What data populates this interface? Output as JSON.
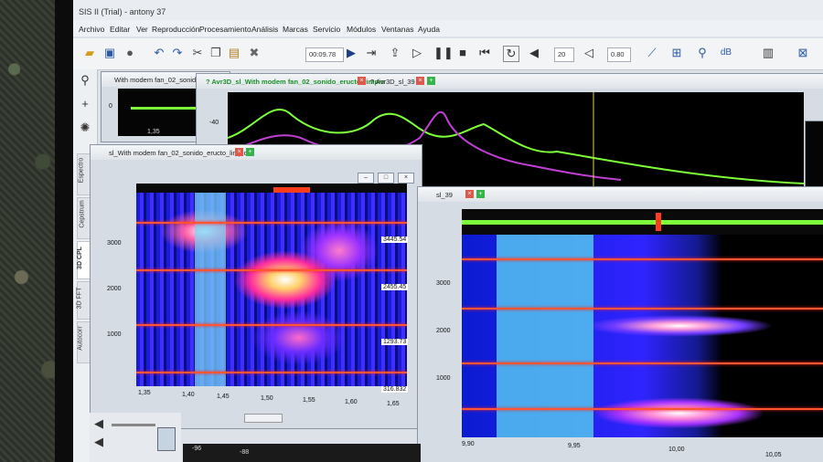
{
  "app": {
    "title": "SIS II (Trial) - antony 37"
  },
  "menu": [
    "Archivo",
    "Editar",
    "Ver",
    "Reproducción",
    "Procesamiento",
    "Análisis",
    "Marcas",
    "Servicio",
    "Módulos",
    "Ventanas",
    "Ayuda"
  ],
  "toolbar": {
    "time": "00:09.78",
    "volume_value": "20",
    "speed_value": "0.80",
    "db_label": "dB"
  },
  "side_tabs": [
    "Espectro",
    "Cepstrum",
    "3D CPL",
    "3D FFT",
    "Autocorr"
  ],
  "windows": {
    "back": {
      "title": "With modem fan_02_sonido",
      "y_label": "0",
      "x_label": "1,35"
    },
    "avr": {
      "tab_active": "? Avr3D_sl_With modem fan_02_sonido_eructo_limpio",
      "tab2": "? Avr3D_sl_39",
      "y_label": "-40"
    },
    "spec_left": {
      "title": "sl_With modem fan_02_sonido_eructo_limpio",
      "y_ticks": [
        "3000",
        "2000",
        "1000"
      ],
      "x_ticks": [
        "1,35",
        "1,40",
        "1,45",
        "1,50",
        "1,55",
        "1,60",
        "1,65"
      ],
      "freq_values": [
        "3445.54",
        "2455.45",
        "1293.73",
        "316.832"
      ]
    },
    "spec_right": {
      "title": "sl_39",
      "y_ticks": [
        "3000",
        "2000",
        "1000"
      ],
      "x_ticks": [
        "9,90",
        "9,95",
        "10,00",
        "10,05"
      ]
    }
  },
  "bottom": {
    "ruler": [
      "-96",
      "-88"
    ]
  },
  "colors": {
    "waveform": "#7dff3a",
    "orange_lines": "#ff5533",
    "selection": "#49b8ea"
  }
}
